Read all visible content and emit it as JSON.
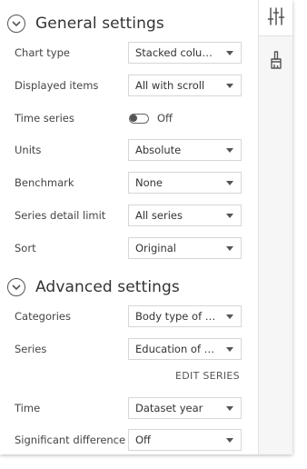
{
  "general": {
    "title": "General settings",
    "rows": [
      {
        "label": "Chart type",
        "value": "Stacked column…"
      },
      {
        "label": "Displayed items",
        "value": "All with scroll"
      },
      {
        "label": "Time series",
        "toggle_text": "Off"
      },
      {
        "label": "Units",
        "value": "Absolute"
      },
      {
        "label": "Benchmark",
        "value": "None"
      },
      {
        "label": "Series detail limit",
        "value": "All series"
      },
      {
        "label": "Sort",
        "value": "Original"
      }
    ]
  },
  "advanced": {
    "title": "Advanced settings",
    "rows": [
      {
        "label": "Categories",
        "value": "Body type of n…"
      },
      {
        "label": "Series",
        "value": "Education of …"
      },
      {
        "label": "Time",
        "value": "Dataset year"
      },
      {
        "label": "Significant difference",
        "value": "Off"
      }
    ],
    "edit_series_label": "EDIT SERIES"
  },
  "rail": {
    "tabs": [
      {
        "icon": "sliders-icon",
        "active": true
      },
      {
        "icon": "paint-brush-icon",
        "active": false
      }
    ]
  }
}
